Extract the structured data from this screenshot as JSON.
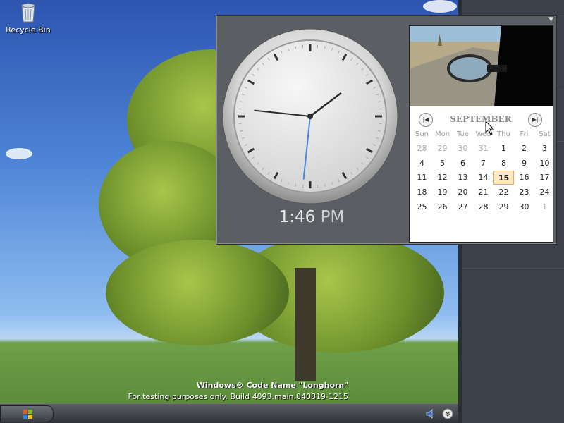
{
  "desktop": {
    "recycle_bin_label": "Recycle Bin",
    "watermark_line1": "Windows® Code Name \"Longhorn\"",
    "watermark_line2": "For testing purposes only. Build 4093.main.040819-1215"
  },
  "clock": {
    "time_digits": "1:46",
    "time_ampm": "PM",
    "hour": 1,
    "minute": 46,
    "second": 31
  },
  "calendar": {
    "month": "SEPTEMBER",
    "prev_label": "|◀",
    "next_label": "▶|",
    "weekdays": [
      "Sun",
      "Mon",
      "Tue",
      "Wed",
      "Thu",
      "Fri",
      "Sat"
    ],
    "weeks": [
      [
        {
          "d": "28",
          "m": true
        },
        {
          "d": "29",
          "m": true
        },
        {
          "d": "30",
          "m": true
        },
        {
          "d": "31",
          "m": true
        },
        {
          "d": "1"
        },
        {
          "d": "2"
        },
        {
          "d": "3"
        }
      ],
      [
        {
          "d": "4"
        },
        {
          "d": "5"
        },
        {
          "d": "6"
        },
        {
          "d": "7"
        },
        {
          "d": "8"
        },
        {
          "d": "9"
        },
        {
          "d": "10"
        }
      ],
      [
        {
          "d": "11"
        },
        {
          "d": "12"
        },
        {
          "d": "13"
        },
        {
          "d": "14"
        },
        {
          "d": "15",
          "today": true
        },
        {
          "d": "16"
        },
        {
          "d": "17"
        }
      ],
      [
        {
          "d": "18"
        },
        {
          "d": "19"
        },
        {
          "d": "20"
        },
        {
          "d": "21"
        },
        {
          "d": "22"
        },
        {
          "d": "23"
        },
        {
          "d": "24"
        }
      ],
      [
        {
          "d": "25"
        },
        {
          "d": "26"
        },
        {
          "d": "27"
        },
        {
          "d": "28"
        },
        {
          "d": "29"
        },
        {
          "d": "30"
        },
        {
          "d": "1",
          "m": true
        }
      ]
    ]
  },
  "icons": {
    "gadget_menu": "chevron-down-icon",
    "start": "windows-flag-icon",
    "volume": "speaker-icon",
    "tray_expand": "expand-chevron-icon"
  }
}
